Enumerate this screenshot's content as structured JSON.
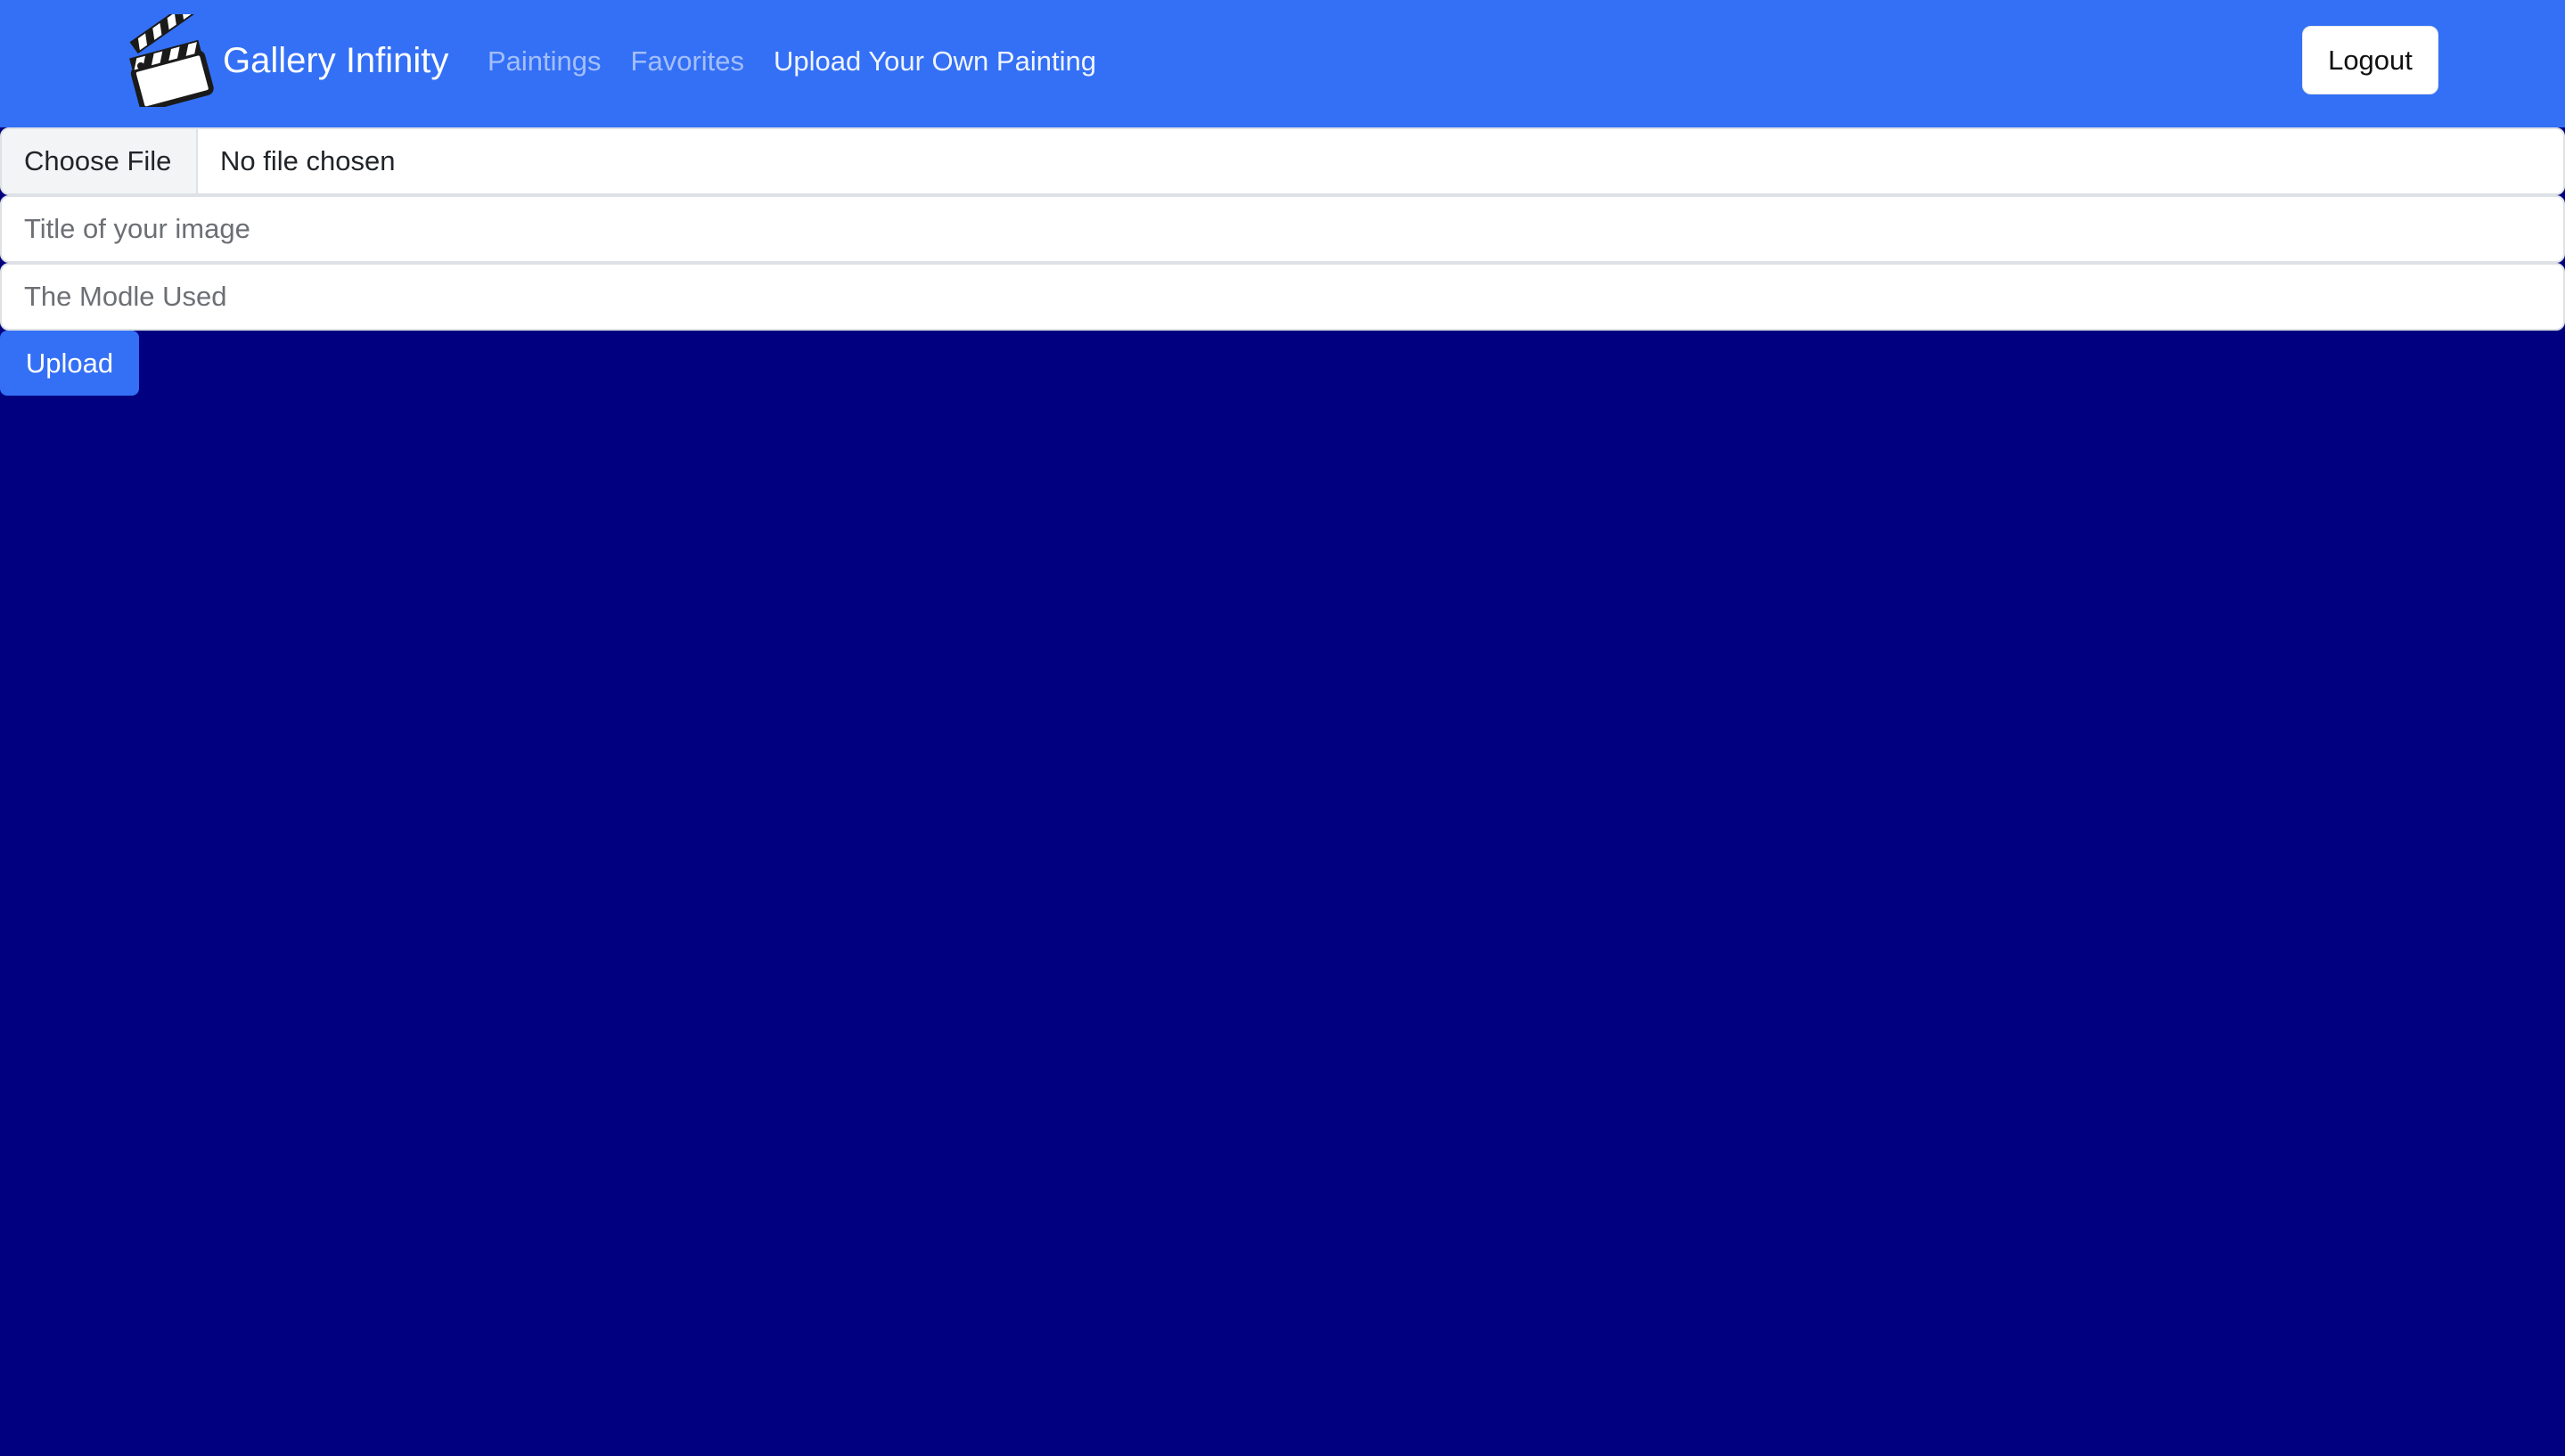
{
  "navbar": {
    "brand": "Gallery Infinity",
    "brand_icon": "clapperboard-icon",
    "links": [
      {
        "label": "Paintings",
        "active": false
      },
      {
        "label": "Favorites",
        "active": false
      },
      {
        "label": "Upload Your Own Painting",
        "active": true
      }
    ],
    "logout_label": "Logout"
  },
  "form": {
    "file_button_label": "Choose File",
    "file_status": "No file chosen",
    "title_placeholder": "Title of your image",
    "model_placeholder": "The Modle Used",
    "upload_label": "Upload"
  },
  "colors": {
    "navbar_bg": "#3470f5",
    "page_bg": "#000080",
    "primary_button": "#3470f5"
  }
}
